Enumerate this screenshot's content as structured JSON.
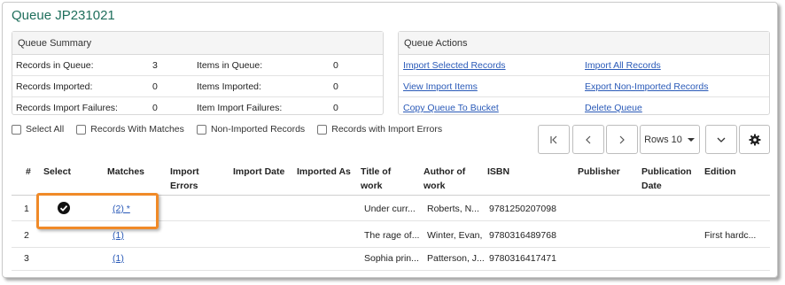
{
  "title": "Queue JP231021",
  "summary": {
    "heading": "Queue Summary",
    "rows": [
      {
        "l1": "Records in Queue:",
        "v1": "3",
        "l2": "Items in Queue:",
        "v2": "0"
      },
      {
        "l1": "Records Imported:",
        "v1": "0",
        "l2": "Items Imported:",
        "v2": "0"
      },
      {
        "l1": "Records Import Failures:",
        "v1": "0",
        "l2": "Item Import Failures:",
        "v2": "0"
      }
    ]
  },
  "actions": {
    "heading": "Queue Actions",
    "rows": [
      {
        "a": "Import Selected Records",
        "b": "Import All Records"
      },
      {
        "a": "View Import Items",
        "b": "Export Non-Imported Records"
      },
      {
        "a": "Copy Queue To Bucket",
        "b": "Delete Queue"
      }
    ]
  },
  "filters": [
    "Select All",
    "Records With Matches",
    "Non-Imported Records",
    "Records with Import Errors"
  ],
  "pager": {
    "rows_label": "Rows 10"
  },
  "columns": [
    "#",
    "Select",
    "Matches",
    "Import\nErrors",
    "Import Date",
    "Imported As",
    "Title of\nwork",
    "Author of\nwork",
    "ISBN",
    "Publisher",
    "Publication\nDate",
    "Edition"
  ],
  "rows": [
    {
      "num": "1",
      "selected": true,
      "matches": "(2) *",
      "title": "Under curr...",
      "author": "Roberts, N...",
      "isbn": "9781250207098",
      "edition": ""
    },
    {
      "num": "2",
      "selected": false,
      "matches": "(1)",
      "title": "The rage of...",
      "author": "Winter, Evan,",
      "isbn": "9780316489768",
      "edition": "First hardc..."
    },
    {
      "num": "3",
      "selected": false,
      "matches": "(1)",
      "title": "Sophia prin...",
      "author": "Patterson, J...",
      "isbn": "9780316417471",
      "edition": ""
    }
  ]
}
